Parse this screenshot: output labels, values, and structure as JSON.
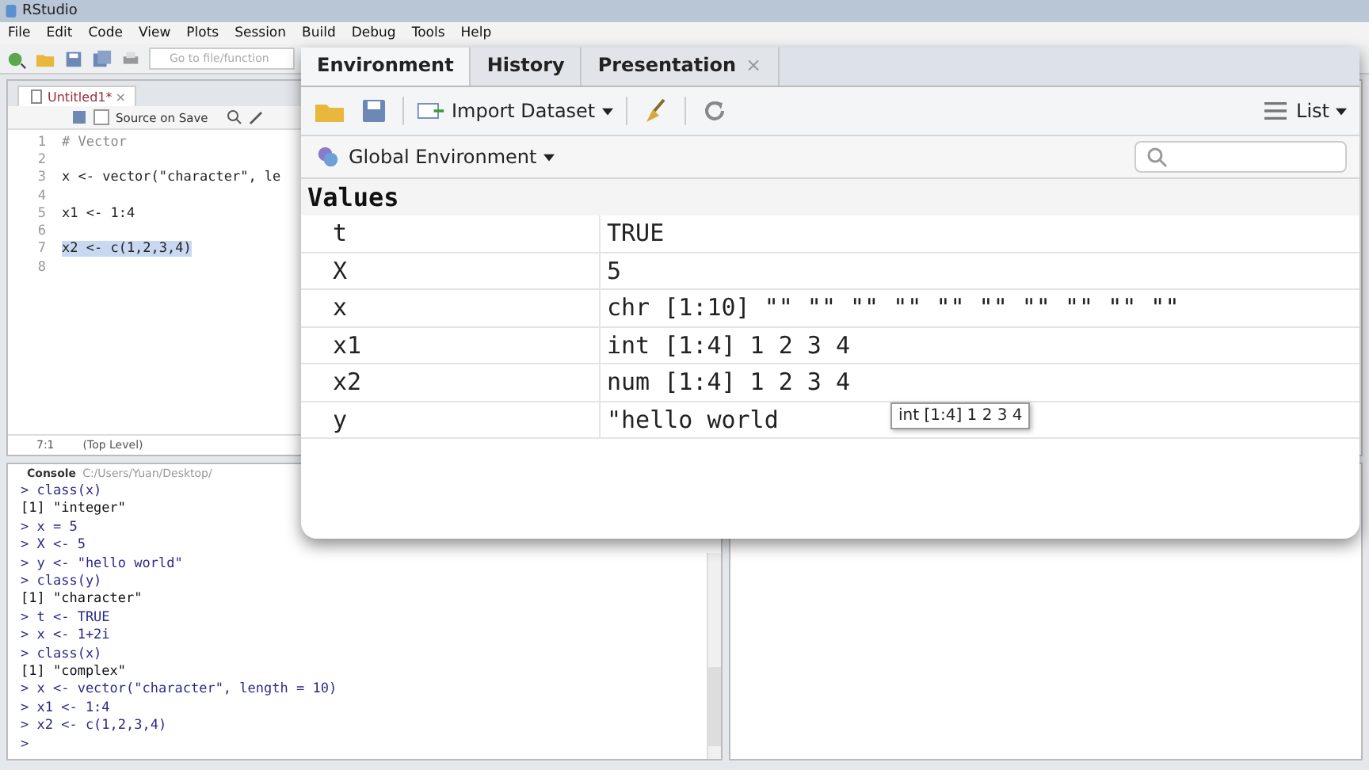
{
  "app_title": "RStudio",
  "menu": [
    "File",
    "Edit",
    "Code",
    "View",
    "Plots",
    "Session",
    "Build",
    "Debug",
    "Tools",
    "Help"
  ],
  "goto_placeholder": "Go to file/function",
  "editor": {
    "tab": {
      "label": "Untitled1*",
      "close": "×"
    },
    "source_on_save": {
      "label": "Source on Save",
      "checked": false
    },
    "lines": [
      {
        "number": "1",
        "code": "# Vector",
        "kind": "comment",
        "selected": false
      },
      {
        "number": "2",
        "selected": false
      },
      {
        "number": "3",
        "code": "x <- vector(\"character\", le",
        "kind": "code",
        "selected": false
      },
      {
        "number": "4",
        "selected": false
      },
      {
        "number": "5",
        "code": "x1 <- 1:4",
        "kind": "code",
        "selected": false
      },
      {
        "number": "6",
        "selected": false
      },
      {
        "number": "7",
        "code": "x2 <- c(1,2,3,4)",
        "kind": "code",
        "selected": true
      },
      {
        "number": "8",
        "selected": false
      }
    ],
    "position": "7:1",
    "scope": "(Top Level)"
  },
  "console": {
    "title": "Console",
    "path": "C:/Users/Yuan/Desktop/",
    "lines": [
      {
        "text": "> class(x)",
        "kind": "input"
      },
      {
        "text": "[1] \"integer\"",
        "kind": "output"
      },
      {
        "text": "> x = 5",
        "kind": "input"
      },
      {
        "text": "> X <- 5",
        "kind": "input"
      },
      {
        "text": "> y <- \"hello world\"",
        "kind": "input"
      },
      {
        "text": "> class(y)",
        "kind": "input"
      },
      {
        "text": "[1] \"character\"",
        "kind": "output"
      },
      {
        "text": "> t <- TRUE",
        "kind": "input"
      },
      {
        "text": "> x <- 1+2i",
        "kind": "input"
      },
      {
        "text": "> class(x)",
        "kind": "input"
      },
      {
        "text": "[1] \"complex\"",
        "kind": "output"
      },
      {
        "text": "> x <- vector(\"character\", length = 10)",
        "kind": "input"
      },
      {
        "text": "> x1 <- 1:4",
        "kind": "input"
      },
      {
        "text": "> x2 <- c(1,2,3,4)",
        "kind": "input"
      }
    ],
    "prompt": ">"
  },
  "environment": {
    "tabs": [
      {
        "label": "Environment",
        "selected": true
      },
      {
        "label": "History",
        "selected": false
      },
      {
        "label": "Presentation",
        "selected": false,
        "close": "×"
      }
    ],
    "import_label": "Import Dataset",
    "view_label": "List",
    "scope_label": "Global Environment",
    "section": "Values",
    "rows": [
      {
        "name": "t",
        "value": "TRUE"
      },
      {
        "name": "X",
        "value": "5"
      },
      {
        "name": "x",
        "value": "chr [1:10] \"\" \"\" \"\" \"\" \"\" \"\" \"\" \"\" \"\" \"\""
      },
      {
        "name": "x1",
        "value": "int [1:4] 1 2 3 4"
      },
      {
        "name": "x2",
        "value": "num [1:4] 1 2 3 4"
      },
      {
        "name": "y",
        "value": "\"hello world"
      }
    ],
    "tooltip": "int [1:4] 1 2 3 4"
  }
}
